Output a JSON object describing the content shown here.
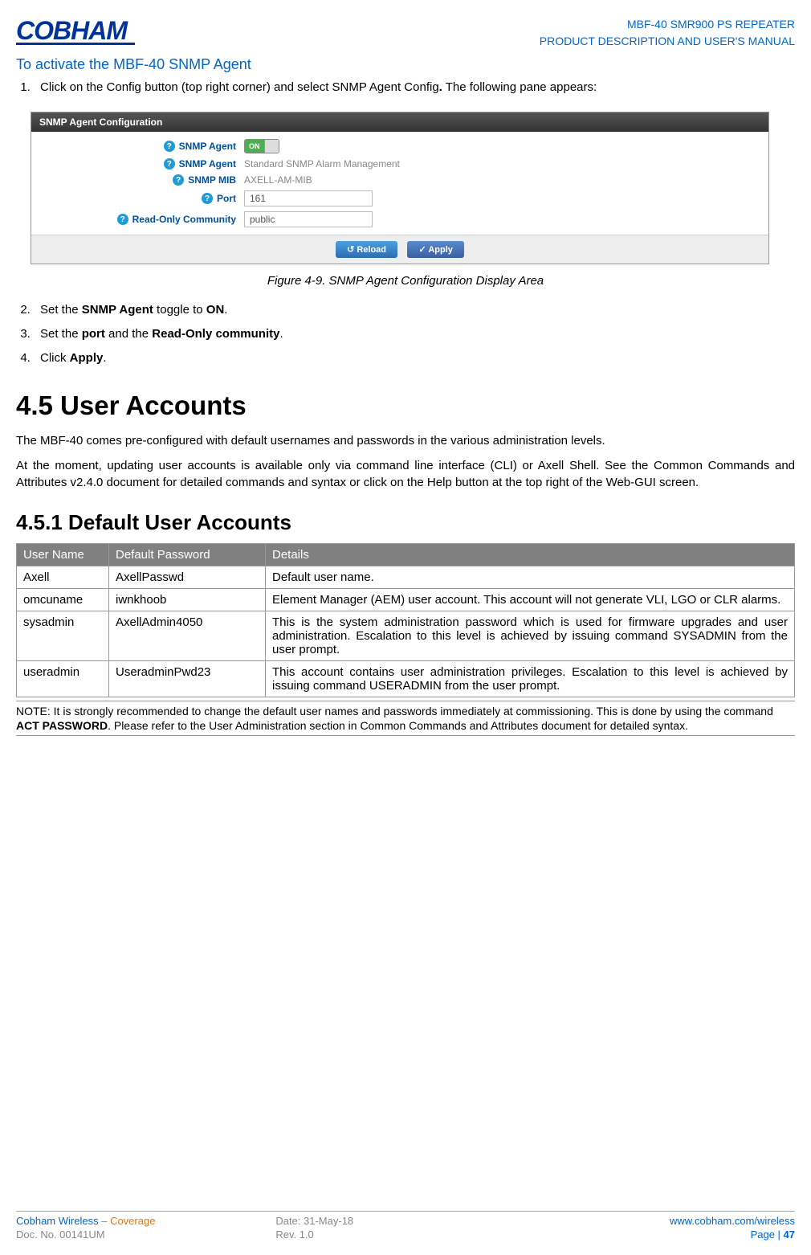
{
  "header": {
    "logo": "COBHAM",
    "line1": "MBF-40 SMR900 PS REPEATER",
    "line2": "PRODUCT DESCRIPTION AND USER'S MANUAL"
  },
  "intro": {
    "title": "To activate the MBF-40 SNMP Agent",
    "step1_pre": "Click on the Config button (top right corner) and select SNMP Agent Config",
    "step1_post": " The following pane appears:"
  },
  "snmp_panel": {
    "title": "SNMP Agent Configuration",
    "rows": [
      {
        "label": "SNMP Agent",
        "type": "toggle",
        "value": "ON"
      },
      {
        "label": "SNMP Agent",
        "type": "text",
        "value": "Standard SNMP Alarm Management"
      },
      {
        "label": "SNMP MIB",
        "type": "text",
        "value": "AXELL-AM-MIB"
      },
      {
        "label": "Port",
        "type": "input",
        "value": "161"
      },
      {
        "label": "Read-Only Community",
        "type": "input",
        "value": "public"
      }
    ],
    "reload": "Reload",
    "apply": "Apply"
  },
  "figure_caption": "Figure 4-9. SNMP Agent Configuration Display Area",
  "steps": {
    "s2_a": "Set the ",
    "s2_b": "SNMP Agent",
    "s2_c": " toggle to ",
    "s2_d": "ON",
    "s2_e": ".",
    "s3_a": "Set the ",
    "s3_b": "port",
    "s3_c": " and the ",
    "s3_d": "Read-Only community",
    "s3_e": ".",
    "s4_a": "Click ",
    "s4_b": "Apply",
    "s4_c": "."
  },
  "section45": {
    "title": "4.5   User Accounts",
    "p1": "The MBF-40 comes pre-configured with default usernames and passwords in the various administration levels.",
    "p2": "At the moment, updating user accounts is available only via command line interface (CLI) or Axell Shell. See the Common Commands and Attributes v2.4.0 document for detailed commands and syntax or click on the Help button at the top right of the Web-GUI screen."
  },
  "section451": {
    "title": "4.5.1 Default User Accounts",
    "headers": [
      "User Name",
      "Default Password",
      "Details"
    ],
    "rows": [
      {
        "user": "Axell",
        "pass": "AxellPasswd",
        "details": "Default user name."
      },
      {
        "user": "omcuname",
        "pass": "iwnkhoob",
        "details": "Element Manager (AEM) user account. This account will not generate VLI, LGO or CLR alarms."
      },
      {
        "user": "sysadmin",
        "pass": "AxellAdmin4050",
        "details": "This is the system administration password which is used for firmware upgrades and user administration. Escalation to this level is achieved by issuing command SYSADMIN from the user prompt."
      },
      {
        "user": "useradmin",
        "pass": "UseradminPwd23",
        "details": "This account contains user administration privileges. Escalation to this level is achieved by issuing command USERADMIN from the user prompt."
      }
    ],
    "note_a": "NOTE: It is strongly recommended to change the default user names and passwords immediately at commissioning. This is done by using the command ",
    "note_b": "ACT PASSWORD",
    "note_c": ". Please refer to the User Administration section in Common Commands and Attributes document for detailed syntax."
  },
  "footer": {
    "l1a": "Cobham Wireless",
    "l1b": " – ",
    "l1c": "Coverage",
    "c1": "Date: 31-May-18",
    "r1": "www.cobham.com/wireless",
    "l2": "Doc. No. 00141UM",
    "c2": "Rev. 1.0",
    "r2a": "Page | ",
    "r2b": "47"
  }
}
